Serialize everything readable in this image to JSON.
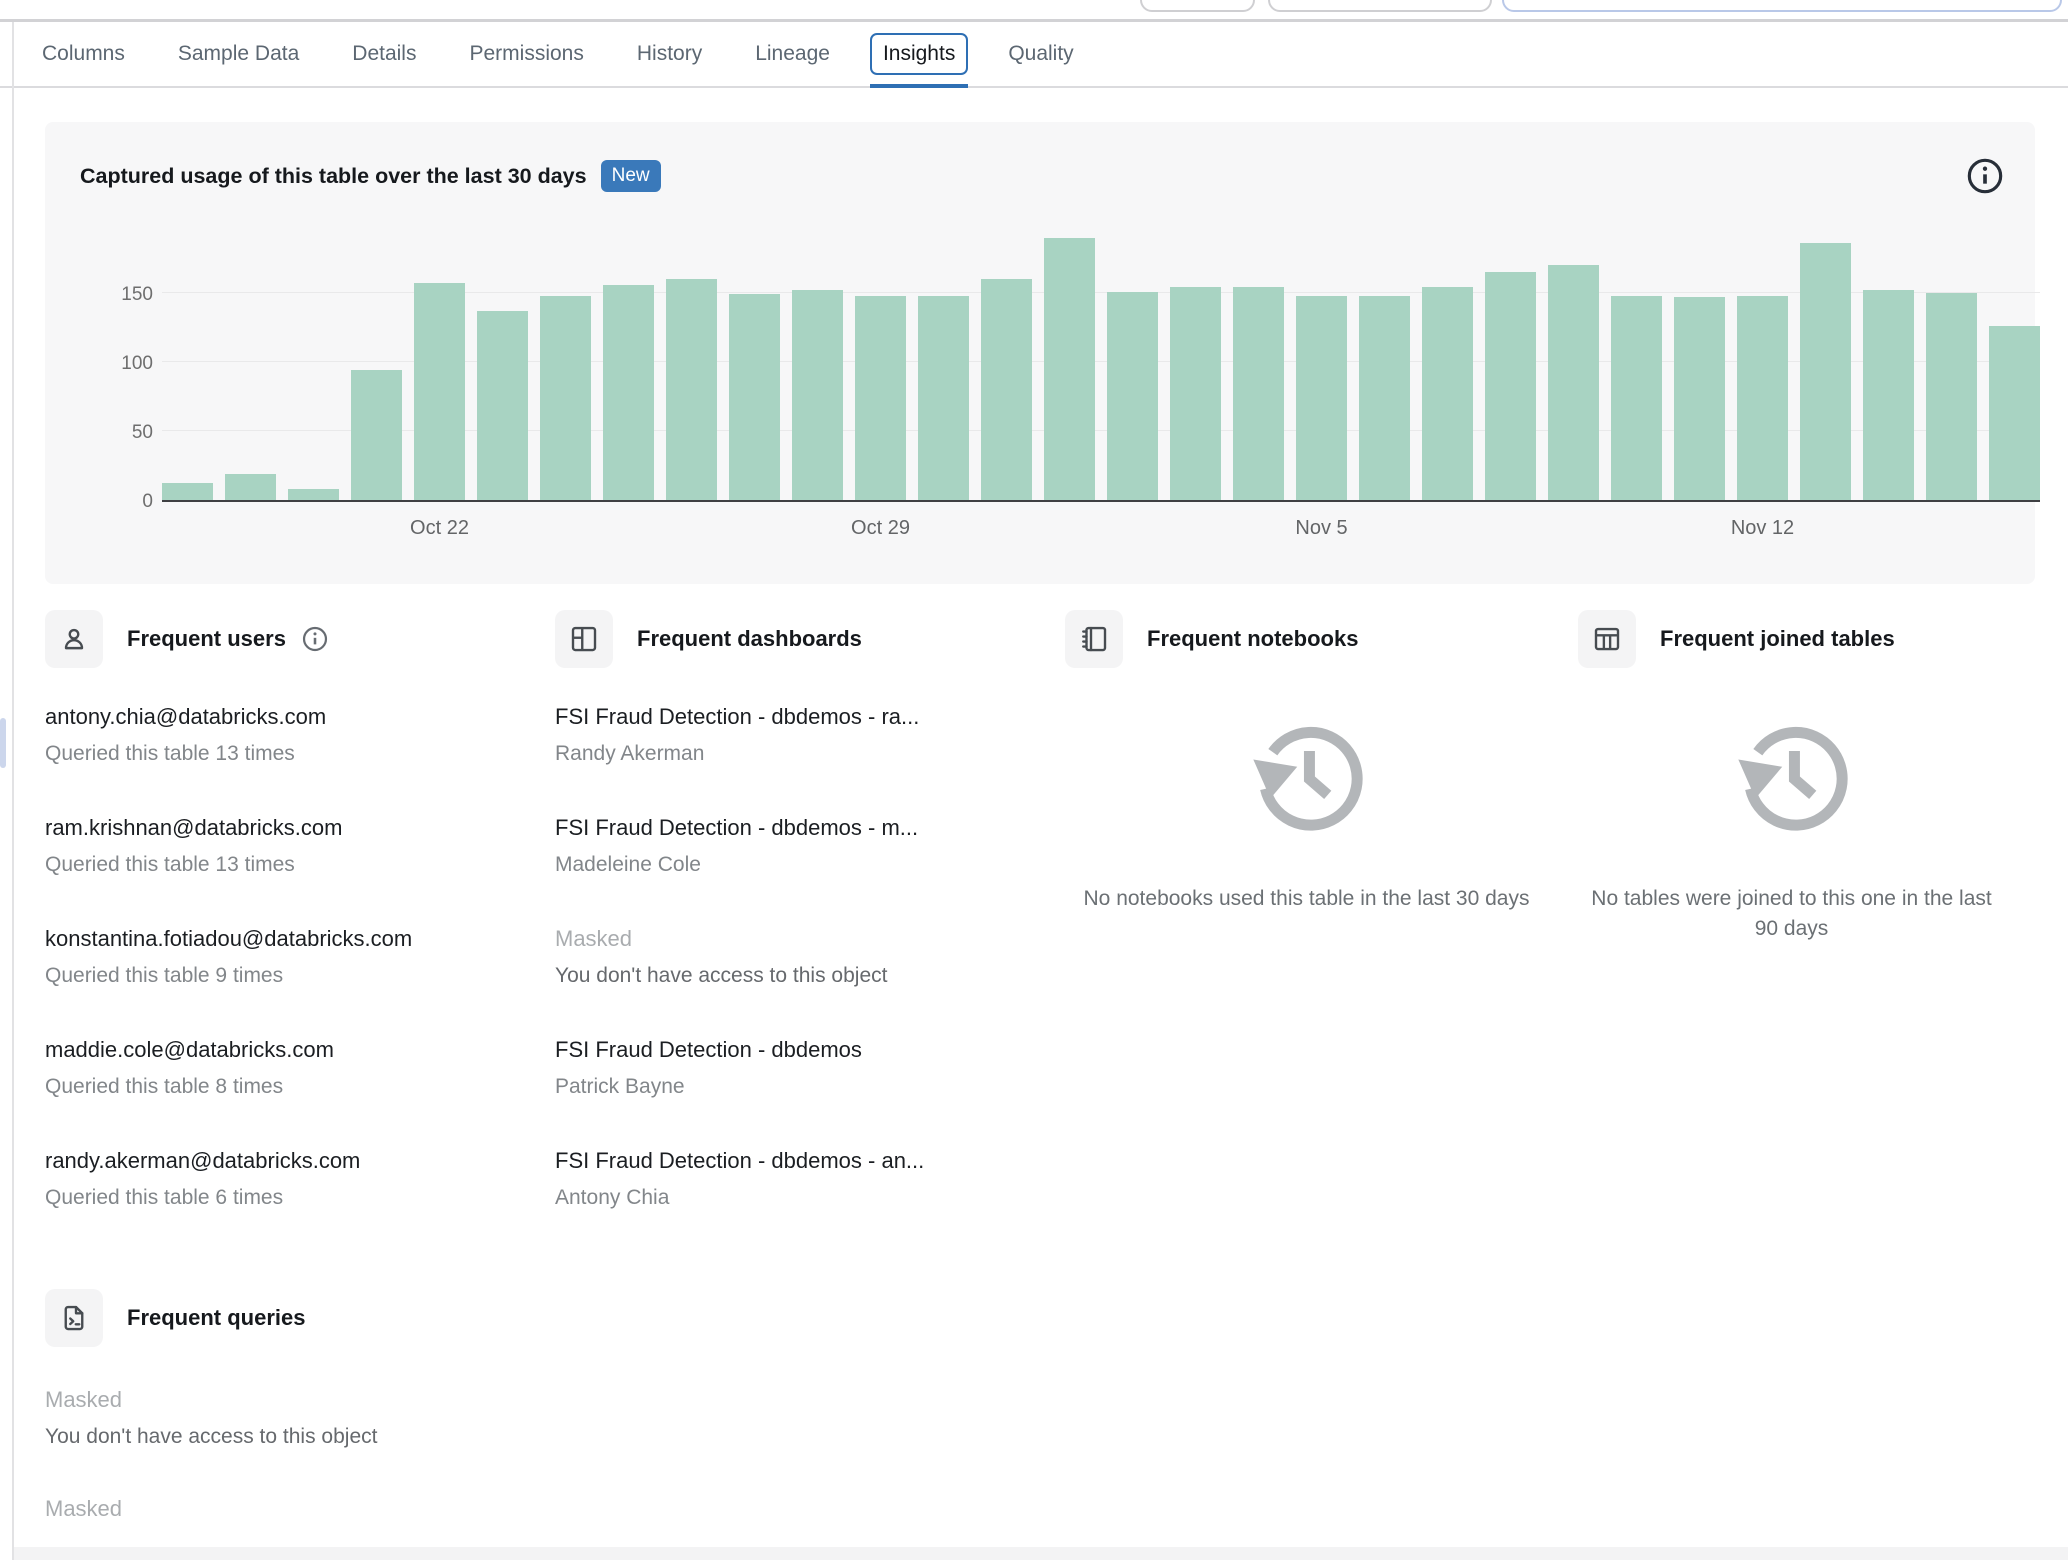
{
  "tabs": {
    "items": [
      {
        "label": "Columns",
        "selected": false
      },
      {
        "label": "Sample Data",
        "selected": false
      },
      {
        "label": "Details",
        "selected": false
      },
      {
        "label": "Permissions",
        "selected": false
      },
      {
        "label": "History",
        "selected": false
      },
      {
        "label": "Lineage",
        "selected": false
      },
      {
        "label": "Insights",
        "selected": true
      },
      {
        "label": "Quality",
        "selected": false
      }
    ]
  },
  "usage_panel": {
    "title": "Captured usage of this table over the last 30 days",
    "badge": "New"
  },
  "chart_data": {
    "type": "bar",
    "title": "Captured usage of this table over the last 30 days",
    "values": [
      12,
      19,
      8,
      94,
      157,
      137,
      148,
      156,
      160,
      149,
      152,
      148,
      148,
      160,
      190,
      151,
      154,
      154,
      148,
      148,
      154,
      165,
      170,
      148,
      147,
      148,
      186,
      152,
      150,
      126
    ],
    "xticks": [
      {
        "label": "Oct 22",
        "index": 4
      },
      {
        "label": "Oct 29",
        "index": 11
      },
      {
        "label": "Nov 5",
        "index": 18
      },
      {
        "label": "Nov 12",
        "index": 25
      }
    ],
    "yticks": [
      0,
      50,
      100,
      150
    ],
    "gridlines": [
      50,
      100,
      150
    ],
    "ylim": [
      0,
      200
    ],
    "bar_color": "#a8d3c2",
    "grid": true,
    "legend": false
  },
  "sections": {
    "users": {
      "title": "Frequent users",
      "items": [
        {
          "primary": "antony.chia@databricks.com",
          "secondary": "Queried this table 13 times",
          "masked": false
        },
        {
          "primary": "ram.krishnan@databricks.com",
          "secondary": "Queried this table 13 times",
          "masked": false
        },
        {
          "primary": "konstantina.fotiadou@databricks.com",
          "secondary": "Queried this table 9 times",
          "masked": false
        },
        {
          "primary": "maddie.cole@databricks.com",
          "secondary": "Queried this table 8 times",
          "masked": false
        },
        {
          "primary": "randy.akerman@databricks.com",
          "secondary": "Queried this table 6 times",
          "masked": false
        }
      ]
    },
    "dashboards": {
      "title": "Frequent dashboards",
      "items": [
        {
          "primary": "FSI Fraud Detection - dbdemos - ra...",
          "secondary": "Randy Akerman",
          "masked": false
        },
        {
          "primary": "FSI Fraud Detection - dbdemos - m...",
          "secondary": "Madeleine Cole",
          "masked": false
        },
        {
          "primary": "Masked",
          "secondary": "You don't have access to this object",
          "masked": true
        },
        {
          "primary": "FSI Fraud Detection - dbdemos",
          "secondary": "Patrick Bayne",
          "masked": false
        },
        {
          "primary": "FSI Fraud Detection - dbdemos - an...",
          "secondary": "Antony Chia",
          "masked": false
        }
      ]
    },
    "notebooks": {
      "title": "Frequent notebooks",
      "empty_text": "No notebooks used this table in the last 30 days"
    },
    "joined_tables": {
      "title": "Frequent joined tables",
      "empty_text": "No tables were joined to this one in the last 90 days"
    },
    "queries": {
      "title": "Frequent queries",
      "items": [
        {
          "primary": "Masked",
          "secondary": "You don't have access to this object",
          "masked": true
        },
        {
          "primary": "Masked",
          "secondary": "",
          "masked": true
        }
      ]
    }
  },
  "colors": {
    "accent_blue": "#2e6fb4",
    "badge_blue": "#3a79ba",
    "bar_green": "#a8d3c2",
    "panel_bg": "#f7f7f8",
    "masked_gray": "#a9acaf",
    "secondary_gray": "#82868a"
  }
}
